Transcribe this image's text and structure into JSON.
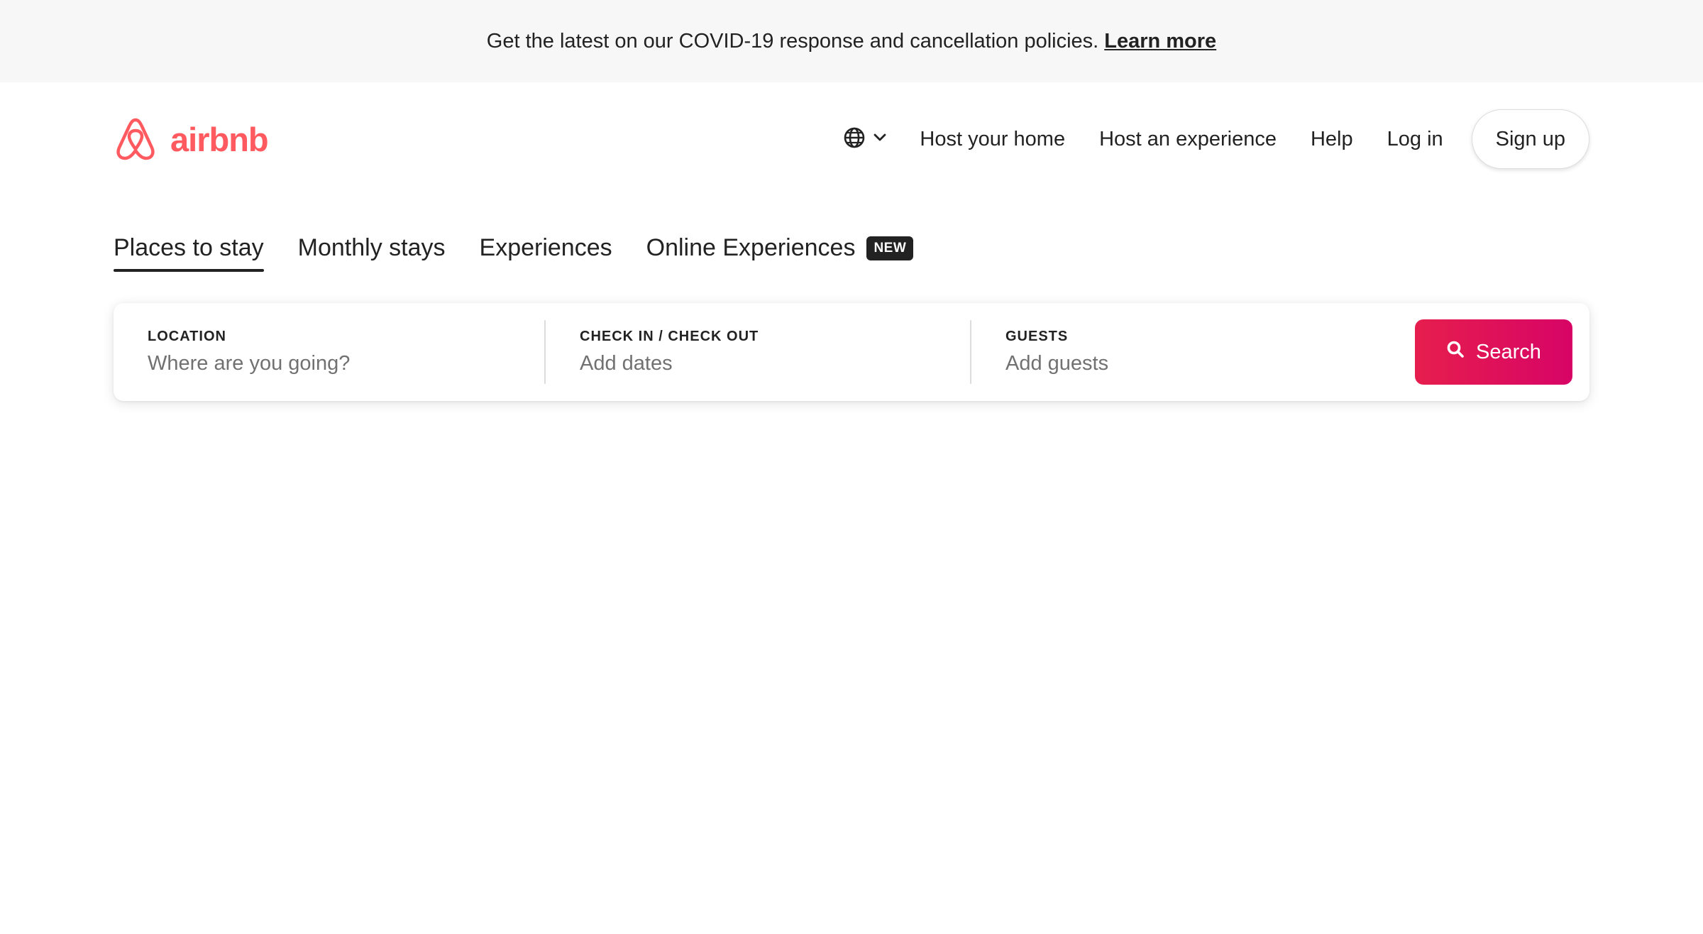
{
  "banner": {
    "text": "Get the latest on our COVID-19 response and cancellation policies.",
    "link_label": "Learn more"
  },
  "logo": {
    "wordmark": "airbnb",
    "icon": "airbnb-belo-icon",
    "brand_color": "#ff5a5f"
  },
  "nav": {
    "language_icon": "globe-icon",
    "language_chevron": "chevron-down-icon",
    "links": [
      "Host your home",
      "Host an experience",
      "Help",
      "Log in"
    ],
    "signup_label": "Sign up"
  },
  "tabs": [
    {
      "label": "Places to stay",
      "active": true
    },
    {
      "label": "Monthly stays",
      "active": false
    },
    {
      "label": "Experiences",
      "active": false
    },
    {
      "label": "Online Experiences",
      "active": false,
      "badge": "NEW"
    }
  ],
  "search": {
    "location": {
      "label": "LOCATION",
      "placeholder": "Where are you going?"
    },
    "dates": {
      "label": "CHECK IN / CHECK OUT",
      "placeholder": "Add dates"
    },
    "guests": {
      "label": "GUESTS",
      "placeholder": "Add guests"
    },
    "button_label": "Search",
    "button_icon": "search-icon",
    "accent_color": "#e61e4d"
  }
}
